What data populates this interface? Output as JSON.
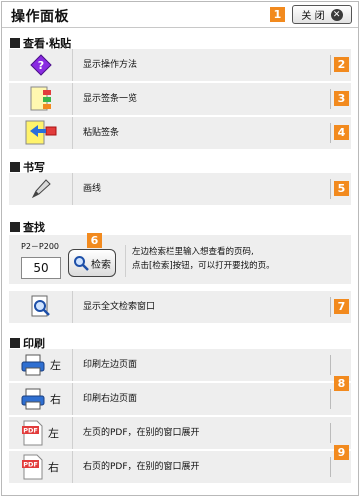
{
  "header": {
    "title": "操作面板",
    "close_label": "关 闭",
    "close_icon_glyph": "✕"
  },
  "badges": [
    "1",
    "2",
    "3",
    "4",
    "5",
    "6",
    "7",
    "8",
    "9"
  ],
  "sections": {
    "view": "查看·粘贴",
    "write": "书写",
    "find": "查找",
    "print": "印刷"
  },
  "view_rows": [
    {
      "icon": "help-diamond-icon",
      "label": "显示操作方法"
    },
    {
      "icon": "sticky-notes-list-icon",
      "label": "显示签条一览"
    },
    {
      "icon": "paste-sticky-arrow-icon",
      "label": "粘贴签条"
    }
  ],
  "write_rows": [
    {
      "icon": "pencil-icon",
      "label": "画线"
    }
  ],
  "search": {
    "range": "P2－P200",
    "page_value": "50",
    "button_label": "检索",
    "description_line1": "左边检索栏里输入想查看的页码,",
    "description_line2": "点击[检索]按钮，可以打开要找的页。",
    "fulltext_label": "显示全文检索窗口"
  },
  "print_rows": [
    {
      "icon": "printer-icon",
      "side": "左",
      "label": "印刷左边页面"
    },
    {
      "icon": "printer-icon",
      "side": "右",
      "label": "印刷右边页面"
    },
    {
      "icon": "pdf-file-icon",
      "side": "左",
      "label": "左页的PDF，在别的窗口展开",
      "pdf_text": "PDF"
    },
    {
      "icon": "pdf-file-icon",
      "side": "右",
      "label": "右页的PDF，在别的窗口展开",
      "pdf_text": "PDF"
    }
  ],
  "colors": {
    "badge": "#f28a1e",
    "row_bg": "#eeeeee",
    "help_purple": "#8a2be2"
  }
}
